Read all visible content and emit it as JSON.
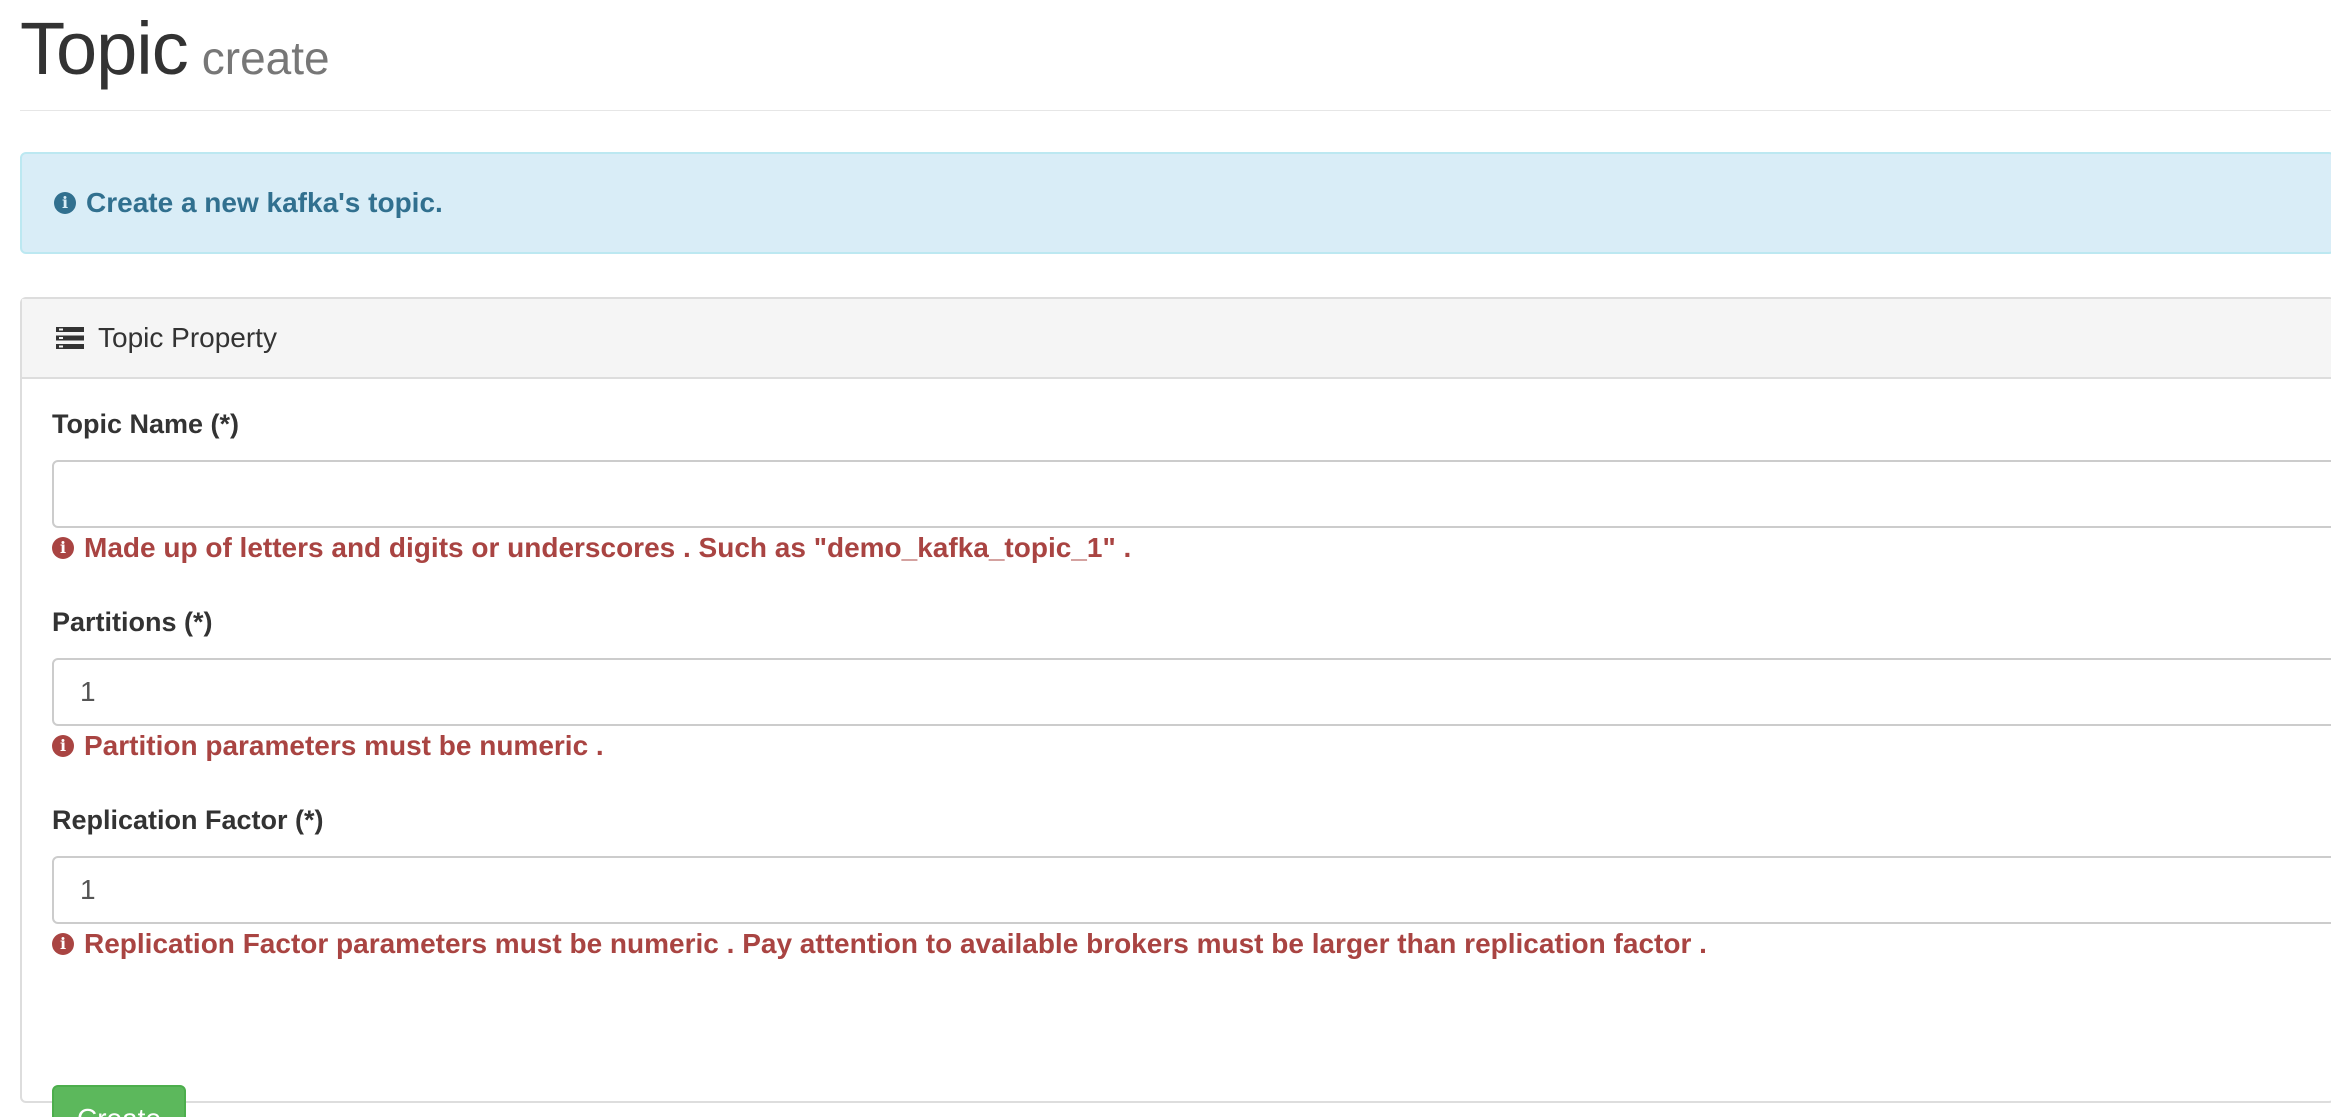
{
  "header": {
    "title": "Topic",
    "subtitle": "create"
  },
  "alert": {
    "text": "Create a new kafka's topic."
  },
  "panel": {
    "title": "Topic Property"
  },
  "form": {
    "topic_name": {
      "label": "Topic Name (*)",
      "value": "",
      "help": "Made up of letters and digits or underscores . Such as \"demo_kafka_topic_1\" ."
    },
    "partitions": {
      "label": "Partitions (*)",
      "value": "1",
      "help": "Partition parameters must be numeric ."
    },
    "replication_factor": {
      "label": "Replication Factor (*)",
      "value": "1",
      "help": "Replication Factor parameters must be numeric . Pay attention to available brokers must be larger than replication factor ."
    },
    "submit_label": "Create"
  },
  "colors": {
    "info_text": "#31708f",
    "info_bg": "#d9edf7",
    "error_text": "#a94442",
    "success_button": "#5cb85c"
  },
  "icons": {
    "info": "info-circle-icon",
    "panel": "tasks-list-icon"
  }
}
